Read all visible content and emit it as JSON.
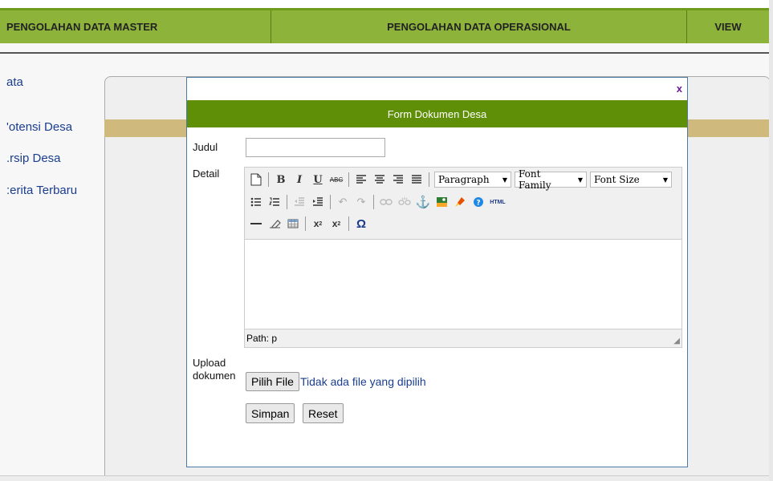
{
  "nav": {
    "master": "PENGOLAHAN DATA MASTER",
    "operasional": "PENGOLAHAN DATA OPERASIONAL",
    "view": "VIEW"
  },
  "sidebar": {
    "items": [
      "ata",
      "'otensi Desa",
      ".rsip Desa",
      ":erita Terbaru"
    ]
  },
  "modal": {
    "close_label": "x",
    "title": "Form Dokumen Desa",
    "judul_label": "Judul",
    "judul_value": "",
    "detail_label": "Detail",
    "upload_label_line1": "Upload",
    "upload_label_line2": "dokumen",
    "file_button": "Pilih File",
    "file_status": "Tidak ada file yang dipilih",
    "save_button": "Simpan",
    "reset_button": "Reset"
  },
  "editor": {
    "format_select": "Paragraph",
    "font_family_select": "Font Family",
    "font_size_select": "Font Size",
    "status_path": "Path: p",
    "html_button": "HTML",
    "omega": "Ω"
  }
}
